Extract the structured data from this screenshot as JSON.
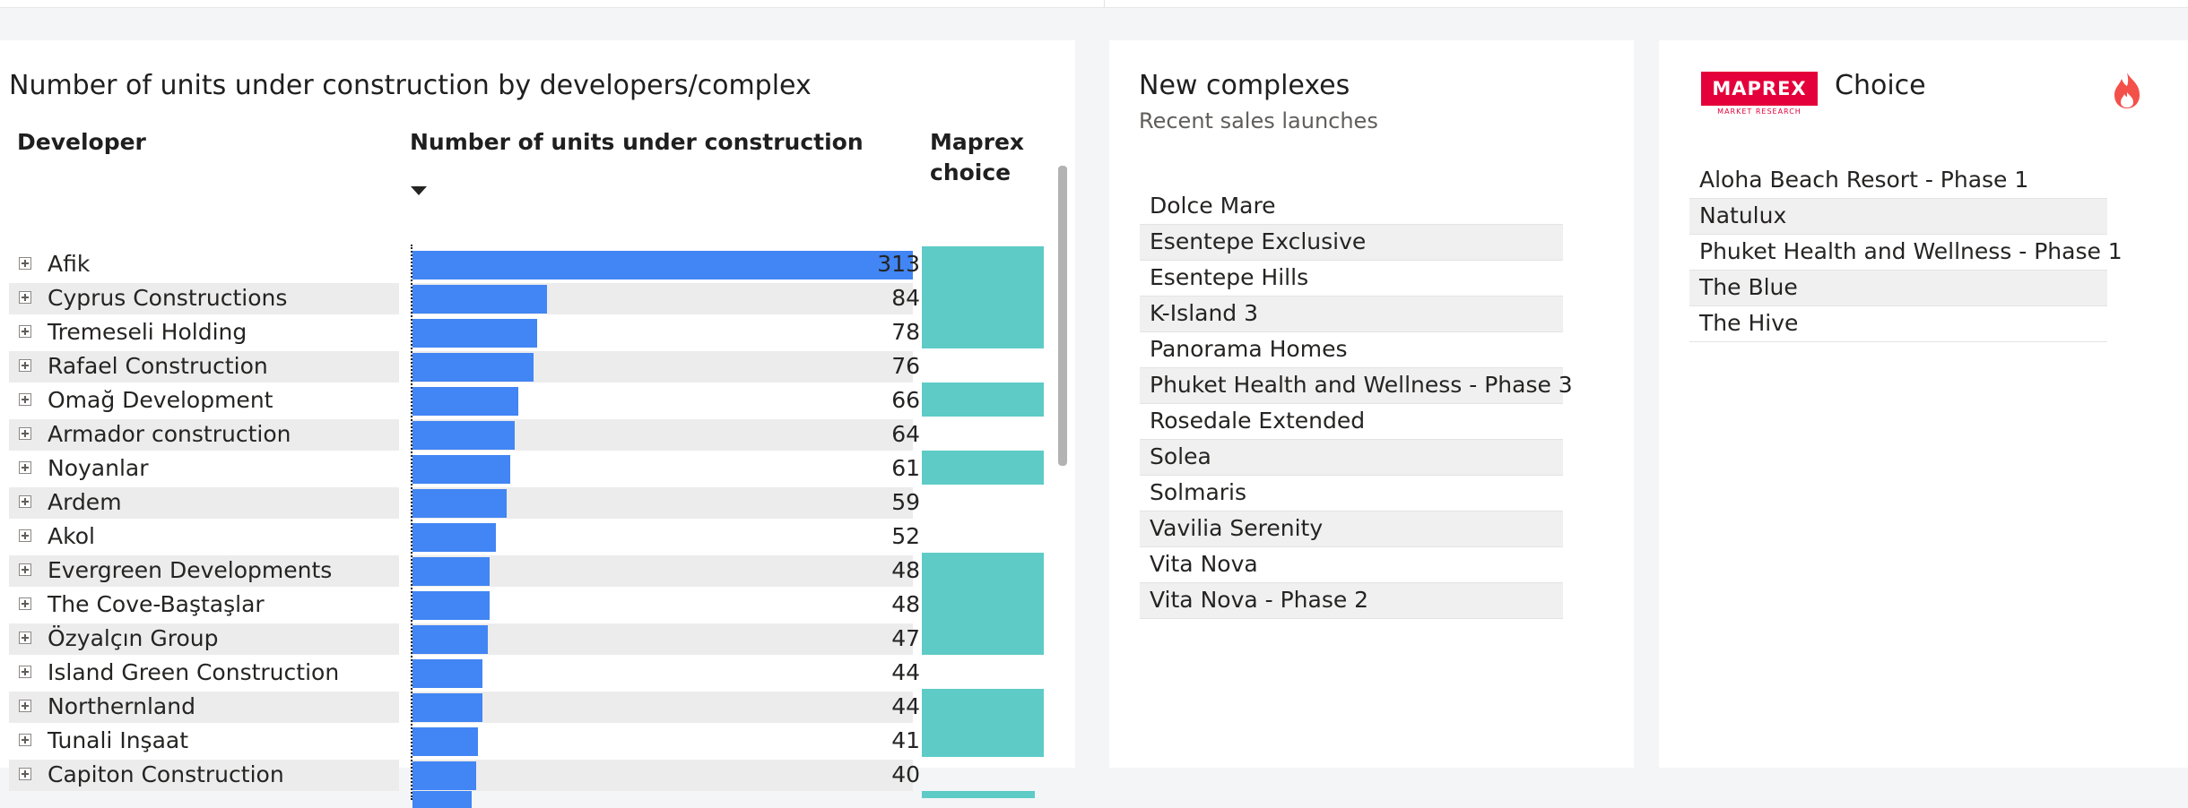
{
  "developers_card": {
    "title": "Number of units under construction by developers/complex",
    "col_developer": "Developer",
    "col_units": "Number of units under construction",
    "col_choice": "Maprex choice",
    "chart_data": {
      "type": "bar",
      "categories": [
        "Afik",
        "Cyprus Constructions",
        "Tremeseli Holding",
        "Rafael Construction",
        "Omağ Development",
        "Armador construction",
        "Noyanlar",
        "Ardem",
        "Akol",
        "Evergreen Developments",
        "The Cove-Baştaşlar",
        "Özyalçın Group",
        "Island Green Construction",
        "Northernland",
        "Tunali Inşaat",
        "Capiton Construction"
      ],
      "values": [
        313,
        84,
        78,
        76,
        66,
        64,
        61,
        59,
        52,
        48,
        48,
        47,
        44,
        44,
        41,
        40
      ],
      "maprex_choice": [
        true,
        true,
        true,
        false,
        true,
        false,
        true,
        false,
        false,
        true,
        true,
        true,
        false,
        true,
        true,
        false
      ],
      "max": 313
    }
  },
  "new_complexes_card": {
    "title": "New complexes",
    "subtitle": "Recent sales launches",
    "items": [
      "Dolce Mare",
      "Esentepe Exclusive",
      "Esentepe Hills",
      "K-Island 3",
      "Panorama Homes",
      "Phuket Health and Wellness - Phase 3",
      "Rosedale Extended",
      "Solea",
      "Solmaris",
      "Vavilia Serenity",
      "Vita Nova",
      "Vita Nova - Phase 2"
    ]
  },
  "choice_card": {
    "logo_text": "MAPREX",
    "logo_subtext": "MARKET RESEARCH",
    "title": "Choice",
    "icon": "fire-icon",
    "items": [
      "Aloha Beach Resort - Phase 1",
      "Natulux",
      "Phuket Health and Wellness - Phase 1",
      "The Blue",
      "The Hive"
    ]
  },
  "colors": {
    "bar": "#4285f4",
    "choice": "#5ecbc6",
    "brand": "#e4003a"
  }
}
